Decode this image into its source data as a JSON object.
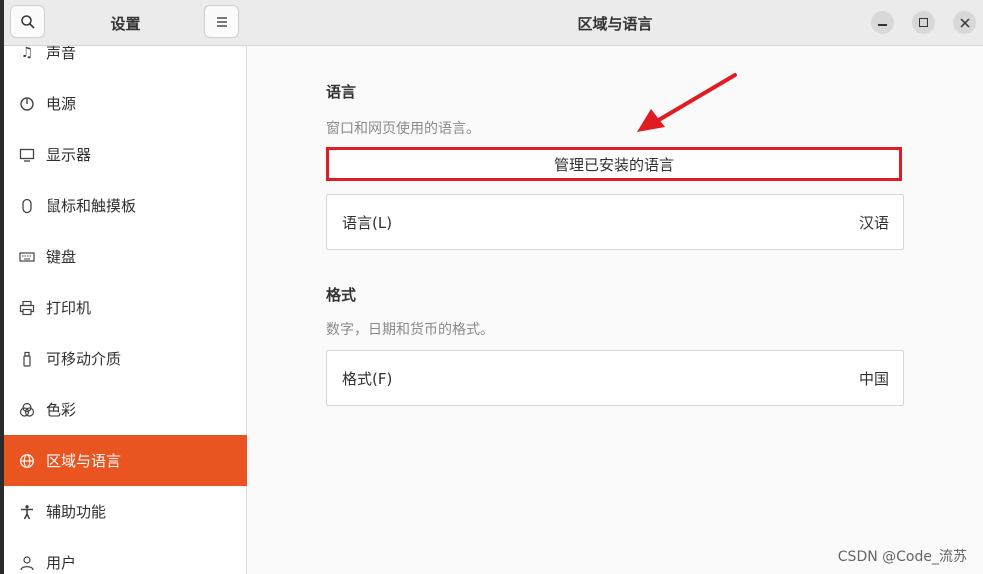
{
  "sidebar": {
    "title": "设置",
    "items": [
      {
        "label": "声音",
        "icon": "music-note-icon"
      },
      {
        "label": "电源",
        "icon": "power-icon"
      },
      {
        "label": "显示器",
        "icon": "monitor-icon"
      },
      {
        "label": "鼠标和触摸板",
        "icon": "mouse-icon"
      },
      {
        "label": "键盘",
        "icon": "keyboard-icon"
      },
      {
        "label": "打印机",
        "icon": "printer-icon"
      },
      {
        "label": "可移动介质",
        "icon": "removable-media-icon"
      },
      {
        "label": "色彩",
        "icon": "color-icon"
      },
      {
        "label": "区域与语言",
        "icon": "globe-icon",
        "active": true
      },
      {
        "label": "辅助功能",
        "icon": "accessibility-icon"
      },
      {
        "label": "用户",
        "icon": "user-icon"
      }
    ]
  },
  "header": {
    "title": "区域与语言"
  },
  "language": {
    "title": "语言",
    "description": "窗口和网页使用的语言。",
    "manage_button": "管理已安装的语言",
    "row_label": "语言(L)",
    "row_value": "汉语"
  },
  "formats": {
    "title": "格式",
    "description": "数字，日期和货币的格式。",
    "row_label": "格式(F)",
    "row_value": "中国"
  },
  "watermark": "CSDN @Code_流苏",
  "colors": {
    "accent": "#e95420",
    "highlight": "#e01b24"
  }
}
